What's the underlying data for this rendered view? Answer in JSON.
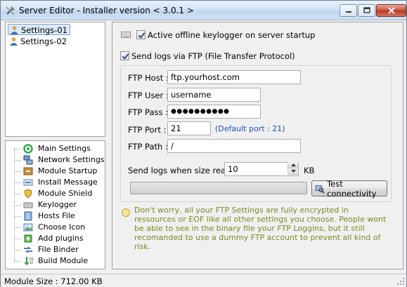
{
  "window": {
    "title": "Server Editor - Installer version < 3.0.1 >"
  },
  "settings_list": [
    {
      "label": "Settings-01"
    },
    {
      "label": "Settings-02"
    }
  ],
  "nav_items": [
    {
      "label": "Main Settings",
      "icon": "main-settings-icon"
    },
    {
      "label": "Network Settings",
      "icon": "network-icon"
    },
    {
      "label": "Module Startup",
      "icon": "startup-icon"
    },
    {
      "label": "Install Message",
      "icon": "message-icon"
    },
    {
      "label": "Module Shield",
      "icon": "shield-icon"
    },
    {
      "label": "Keylogger",
      "icon": "keyboard-icon"
    },
    {
      "label": "Hosts File",
      "icon": "hosts-icon"
    },
    {
      "label": "Choose Icon",
      "icon": "picture-icon"
    },
    {
      "label": "Add plugins",
      "icon": "plugin-icon"
    },
    {
      "label": "File Binder",
      "icon": "binder-icon"
    },
    {
      "label": "Build Module",
      "icon": "build-icon"
    }
  ],
  "keylogger": {
    "offline_label": "Active offline keylogger on server startup",
    "offline_checked": true,
    "ftp_label": "Send logs via FTP (File Transfer Protocol)",
    "ftp_checked": true
  },
  "ftp": {
    "host_label": "FTP Host :",
    "host_value": "ftp.yourhost.com",
    "user_label": "FTP User :",
    "user_value": "username",
    "pass_label": "FTP Pass :",
    "pass_value": "●●●●●●●●●●",
    "port_label": "FTP Port :",
    "port_value": "21",
    "port_hint": "(Default port : 21)",
    "path_label": "FTP Path :",
    "path_value": "/",
    "size_label": "Send logs when size reach :",
    "size_value": "10",
    "size_unit": "KB",
    "test_button": "Test connectivity"
  },
  "note": "Don't worry, all your FTP Settings are fully encrypted in ressources or EOF like all other settings you choose. People wont be able to see in the binary file your FTP Loggins, but it still recomanded to use a dummy FTP account to prevent all kind of risk.",
  "status": {
    "module_size": "Module Size : 712.00 KB"
  },
  "colors": {
    "note_text": "#7d8a24",
    "hint_text": "#1d4ec8",
    "selection": "#dbe8f7"
  }
}
